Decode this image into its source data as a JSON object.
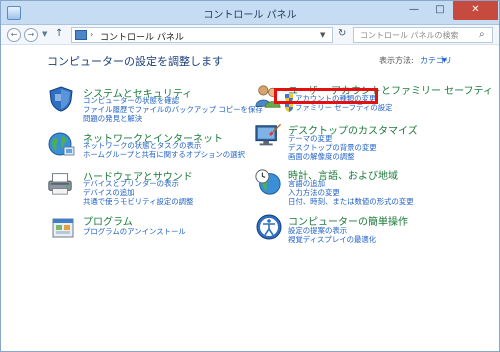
{
  "window": {
    "title": "コントロール パネル",
    "minimize": "—",
    "maximize": "□",
    "close": "✕"
  },
  "address": {
    "back": "←",
    "forward": "→",
    "up": "↑",
    "separator": "›",
    "path": "コントロール パネル",
    "refresh": "↻",
    "search_placeholder": "コントロール パネルの検索",
    "search_glyph": "⌕"
  },
  "main": {
    "heading": "コンピューターの設定を調整します",
    "view_by_label": "表示方法:",
    "view_by_value": "カテゴリ"
  },
  "categories_left": [
    {
      "title": "システムとセキュリティ",
      "icon": "shield-icon",
      "links": [
        "コンピューターの状態を確認",
        "ファイル履歴でファイルのバックアップ コピーを保存",
        "問題の発見と解決"
      ]
    },
    {
      "title": "ネットワークとインターネット",
      "icon": "network-globe-icon",
      "links": [
        "ネットワークの状態とタスクの表示",
        "ホームグループと共有に関するオプションの選択"
      ]
    },
    {
      "title": "ハードウェアとサウンド",
      "icon": "printer-icon",
      "links": [
        "デバイスとプリンターの表示",
        "デバイスの追加",
        "共通で使うモビリティ設定の調整"
      ]
    },
    {
      "title": "プログラム",
      "icon": "programs-icon",
      "links": [
        "プログラムのアンインストール"
      ]
    }
  ],
  "categories_right": [
    {
      "title": "ユーザー アカウントとファミリー セーフティ",
      "icon": "users-icon",
      "links": [
        "アカウントの種類の変更",
        "ファミリー セーフティの設定"
      ]
    },
    {
      "title": "デスクトップのカスタマイズ",
      "icon": "desktop-brush-icon",
      "links": [
        "テーマの変更",
        "デスクトップの背景の変更",
        "画面の解像度の調整"
      ]
    },
    {
      "title": "時計、言語、および地域",
      "icon": "clock-globe-icon",
      "links": [
        "言語の追加",
        "入力方法の変更",
        "日付、時刻、または数値の形式の変更"
      ]
    },
    {
      "title": "コンピューターの簡単操作",
      "icon": "ease-of-access-icon",
      "links": [
        "設定の提案の表示",
        "視覚ディスプレイの最適化"
      ]
    }
  ],
  "colors": {
    "title_green": "#1d7a3c",
    "link_blue": "#1f61c6",
    "highlight_red": "#e41010"
  }
}
